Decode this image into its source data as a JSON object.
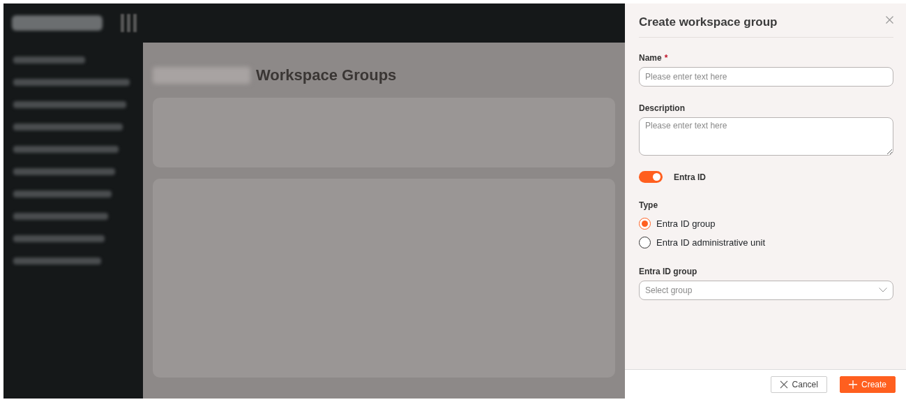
{
  "backdrop": {
    "page_title": "Workspace Groups"
  },
  "panel": {
    "title": "Create workspace group",
    "fields": [
      {
        "kind": "text",
        "label": "Name",
        "required_mark": "*",
        "placeholder": "Please enter text here"
      },
      {
        "kind": "textarea",
        "label": "Description",
        "placeholder": "Please enter text here"
      },
      {
        "kind": "switch",
        "label": "Entra ID",
        "on": true
      },
      {
        "kind": "radio",
        "label": "Type",
        "options": [
          {
            "label": "Entra ID group",
            "selected": true
          },
          {
            "label": "Entra ID administrative unit",
            "selected": false
          }
        ]
      },
      {
        "kind": "select",
        "label": "Entra ID group",
        "placeholder": "Select group"
      }
    ],
    "buttons": [
      {
        "kind": "secondary",
        "label": "Cancel"
      },
      {
        "kind": "primary",
        "label": "Create"
      }
    ]
  }
}
